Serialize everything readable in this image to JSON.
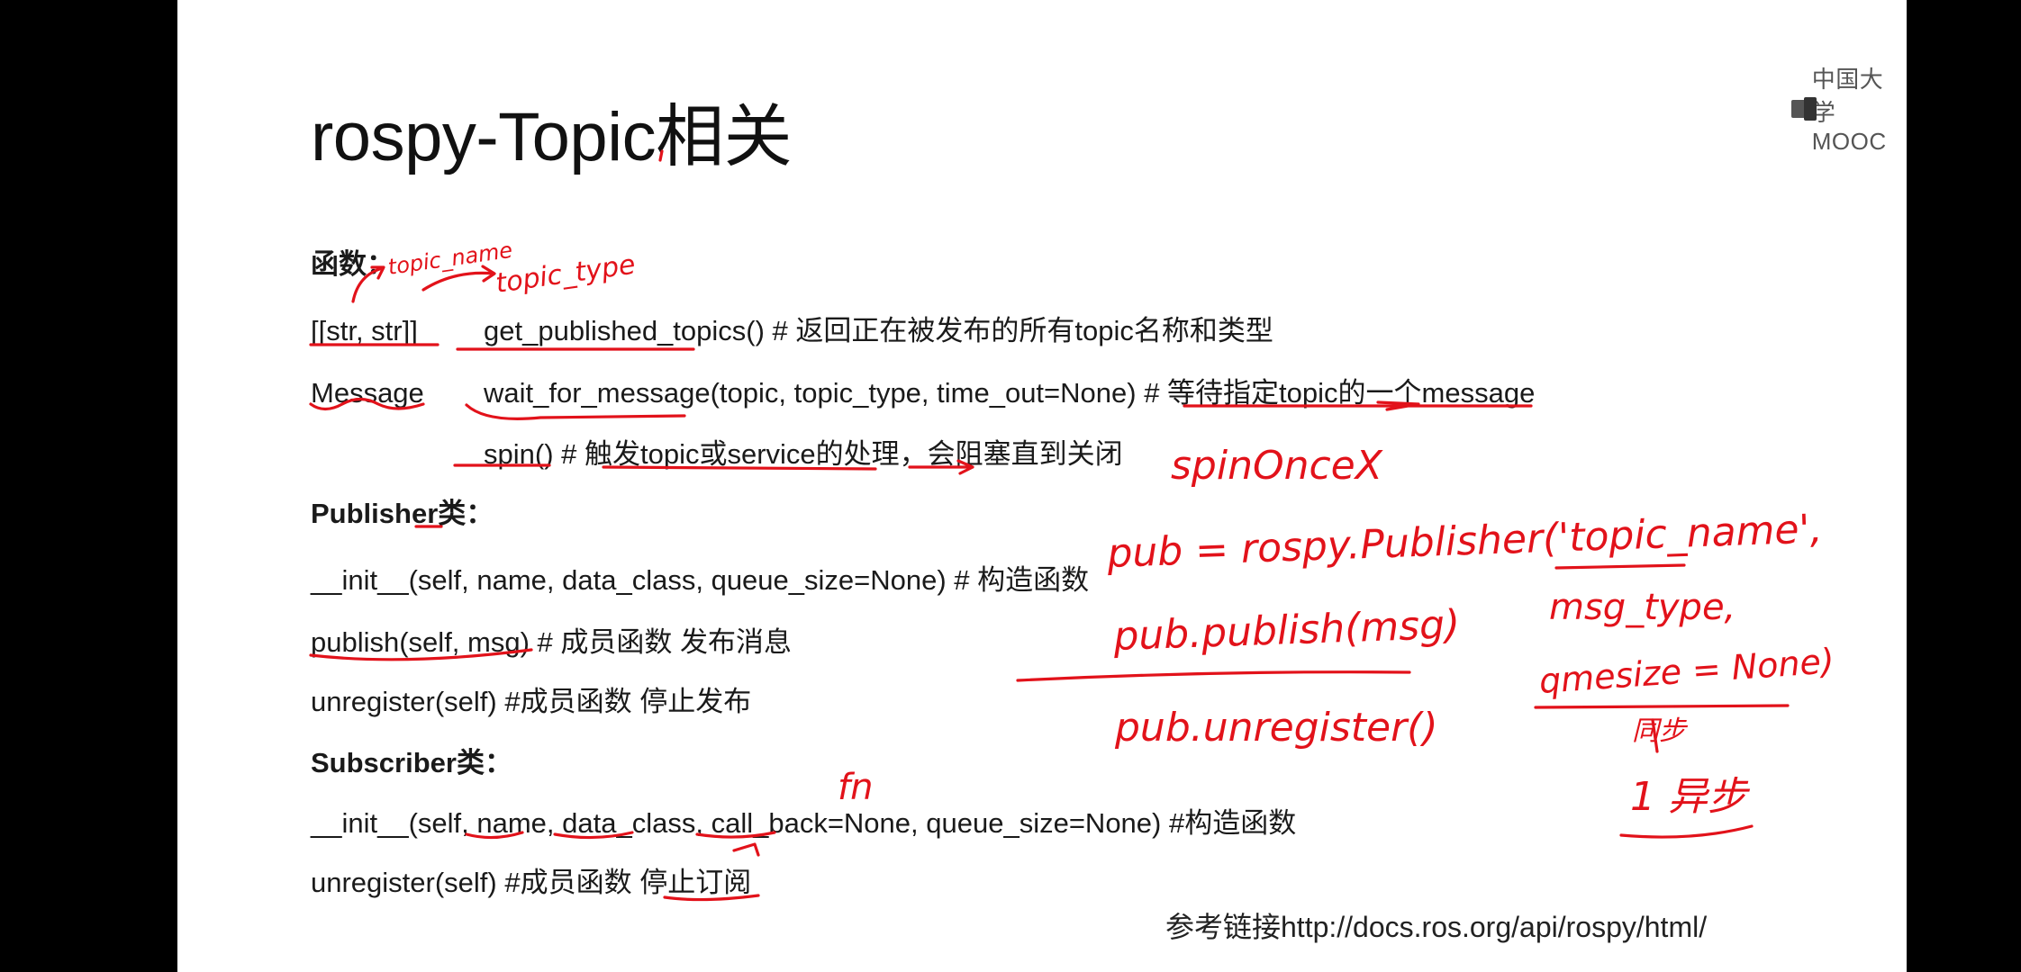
{
  "slide": {
    "logo_text": "中国大学MOOC",
    "title": "rospy-Topic相关",
    "reference": "参考链接http://docs.ros.org/api/rospy/html/"
  },
  "functions_section": {
    "heading": "函数：",
    "rows": [
      {
        "ret": "[[str, str]]",
        "code": "get_published_topics() # 返回正在被发布的所有topic名称和类型"
      },
      {
        "ret": "Message",
        "code": "wait_for_message(topic, topic_type, time_out=None) # 等待指定topic的一个message"
      },
      {
        "ret": "",
        "code": "spin() # 触发topic或service的处理，会阻塞直到关闭"
      }
    ]
  },
  "publisher_section": {
    "heading": "Publisher类：",
    "rows": [
      "__init__(self, name, data_class, queue_size=None)  # 构造函数",
      "publish(self, msg) # 成员函数 发布消息",
      "unregister(self) #成员函数 停止发布"
    ]
  },
  "subscriber_section": {
    "heading": "Subscriber类：",
    "rows": [
      "__init__(self, name, data_class, call_back=None, queue_size=None) #构造函数",
      "unregister(self) #成员函数 停止订阅"
    ]
  },
  "handwriting": {
    "topic_name": "topic_name",
    "topic_type": "topic_type",
    "spinonce": "spinOnceX",
    "pub_create": "pub = rospy.Publisher('topic_name',",
    "msg_type": "msg_type,",
    "queue_size": "qmesize = None)",
    "pub_publish": "pub.publish(msg)",
    "pub_unregister": "pub.unregister()",
    "fn": "fn",
    "sync": "同步",
    "async": "1 异步"
  },
  "colors": {
    "ink": "#e2121a",
    "text": "#1a1a1a",
    "slide_bg": "#ffffff",
    "frame": "#000000"
  }
}
